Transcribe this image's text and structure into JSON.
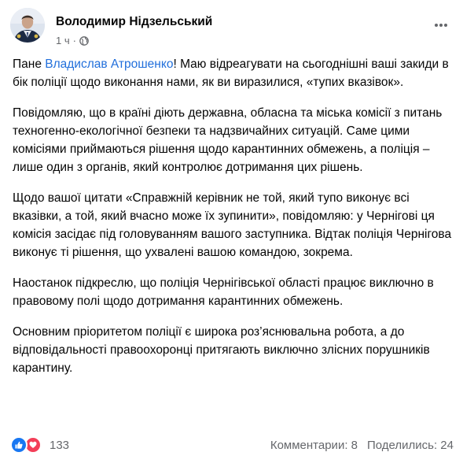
{
  "post": {
    "author": "Володимир Нідзельський",
    "time": "1 ч",
    "privacy_icon": "globe-icon",
    "more_icon": "more-icon",
    "paragraphs": [
      {
        "prefix": "Пане ",
        "mention": "Владислав Атрошенко",
        "suffix": "! Маю відреагувати на сьогоднішні ваші закиди в бік поліції щодо виконання нами, як ви виразилися, «тупих вказівок»."
      },
      {
        "text": "Повідомляю, що в країні діють державна, обласна та міська комісії з питань техногенно-екологічної безпеки та надзвичайних ситуацій. Саме цими комісіями приймаються рішення щодо карантинних обмежень, а поліція – лише один з органів, який контролює дотримання цих рішень."
      },
      {
        "text": "Щодо вашої цитати «Справжній керівник не той, який тупо виконує всі вказівки, а той, який вчасно може їх зупинити», повідомляю: у Чернігові ця комісія засідає під головуванням вашого заступника. Відтак поліція Чернігова виконує ті рішення, що ухвалені вашою командою, зокрема."
      },
      {
        "text": "Наостанок підкреслю, що поліція Чернігівської області працює виключно в правовому полі щодо дотримання карантинних обмежень."
      },
      {
        "text": "Основним пріоритетом поліції є широка роз’яснювальна робота, а до відповідальності правоохоронці притягають виключно злісних порушників карантину."
      }
    ],
    "reactions": {
      "icons": [
        "like-icon",
        "love-icon"
      ],
      "count": "133",
      "like_color": "#1877f2",
      "love_color": "#f33e58"
    },
    "comments": "Комментарии: 8",
    "shares": "Поделились: 24"
  },
  "colors": {
    "text": "#050505",
    "secondary": "#65676b",
    "link": "#216fdb"
  }
}
